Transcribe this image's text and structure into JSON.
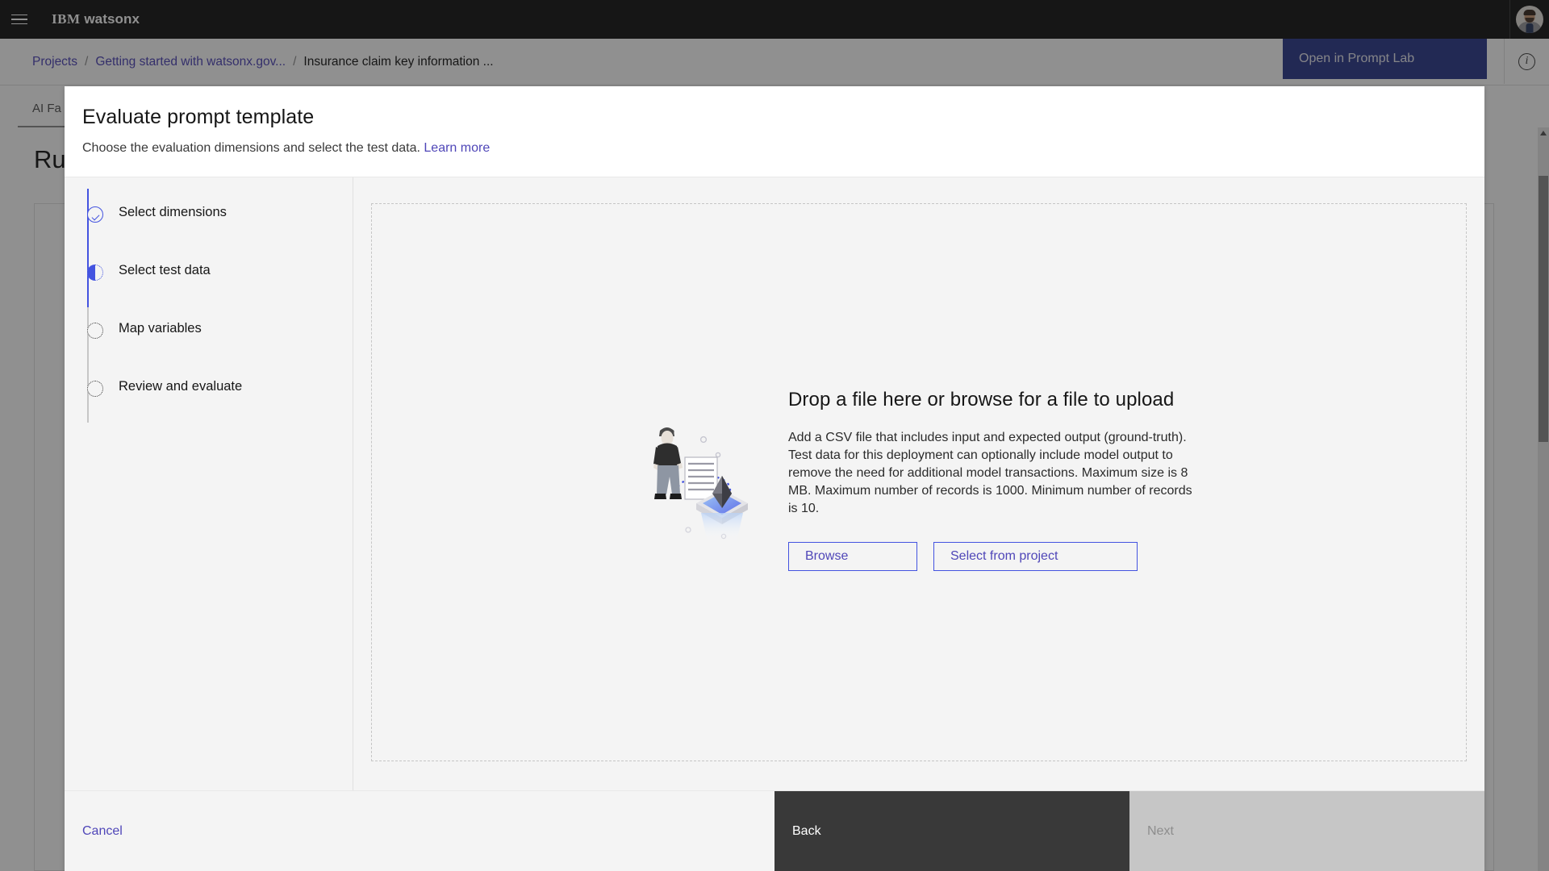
{
  "topnav": {
    "menu_icon": "hamburger-menu-icon",
    "brand_prefix": "IBM",
    "brand_name": "watsonx",
    "avatar_icon": "user-avatar-photo"
  },
  "breadcrumb": {
    "items": [
      "Projects",
      "Getting started with watsonx.gov...",
      "Insurance claim key information ..."
    ],
    "separator": "/",
    "prompt_lab_button": "Open in Prompt Lab",
    "info_icon": "information-icon",
    "info_glyph": "i"
  },
  "background_page": {
    "tab_label": "AI Fa",
    "title": "Run"
  },
  "modal": {
    "title": "Evaluate prompt template",
    "subtitle": "Choose the evaluation dimensions and select the test data.",
    "learn_more": "Learn more",
    "steps": [
      {
        "label": "Select dimensions",
        "state": "complete"
      },
      {
        "label": "Select test data",
        "state": "current"
      },
      {
        "label": "Map variables",
        "state": "incomplete"
      },
      {
        "label": "Review and evaluate",
        "state": "incomplete"
      }
    ],
    "dropzone": {
      "illustration": "upload-data-illustration",
      "heading": "Drop a file here or browse for a file to upload",
      "description": "Add a CSV file that includes input and expected output (ground-truth). Test data for this deployment can optionally include model output to remove the need for additional model transactions. Maximum size is 8 MB. Maximum number of records is 1000. Minimum number of records is 10.",
      "browse_button": "Browse",
      "select_project_button": "Select from project"
    },
    "footer": {
      "cancel": "Cancel",
      "back": "Back",
      "next": "Next"
    }
  },
  "colors": {
    "brand_blue": "#4353e0",
    "link_purple": "#4f46b8",
    "prompt_lab_blue": "#2d3a8c",
    "dark_header": "#161616",
    "panel_gray": "#f4f4f4",
    "disabled_gray": "#c6c6c6"
  }
}
